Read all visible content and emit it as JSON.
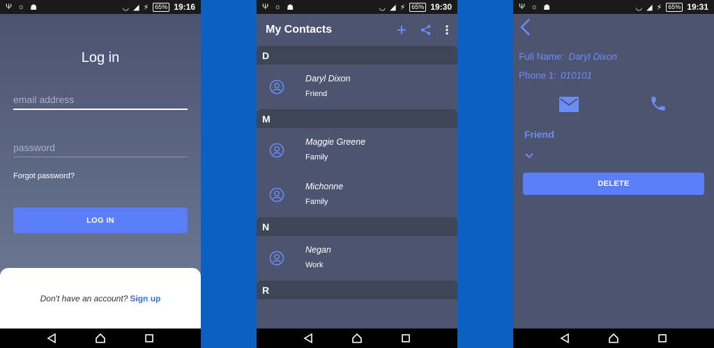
{
  "screens": {
    "login": {
      "status": {
        "battery": "65%",
        "time": "19:16"
      },
      "title": "Log in",
      "email_placeholder": "email address",
      "password_placeholder": "password",
      "forgot_label": "Forgot password?",
      "login_button": "LOG IN",
      "signup_prompt": "Don't have an account?",
      "signup_link": "Sign up"
    },
    "contacts": {
      "status": {
        "battery": "65%",
        "time": "19:30"
      },
      "title": "My Contacts",
      "sections": [
        {
          "letter": "D",
          "contacts": [
            {
              "name": "Daryl Dixon",
              "group": "Friend"
            }
          ]
        },
        {
          "letter": "M",
          "contacts": [
            {
              "name": "Maggie Greene",
              "group": "Family"
            },
            {
              "name": "Michonne",
              "group": "Family"
            }
          ]
        },
        {
          "letter": "N",
          "contacts": [
            {
              "name": "Negan",
              "group": "Work"
            }
          ]
        },
        {
          "letter": "R",
          "contacts": []
        }
      ]
    },
    "detail": {
      "status": {
        "battery": "65%",
        "time": "19:31"
      },
      "full_name_label": "Full Name:",
      "full_name": "Daryl Dixon",
      "phone_label": "Phone 1:",
      "phone": "010101",
      "group": "Friend",
      "delete_button": "DELETE"
    }
  },
  "colors": {
    "accent": "#5b7ef8",
    "background": "#0A5FC2",
    "screen": "#4d5470"
  }
}
